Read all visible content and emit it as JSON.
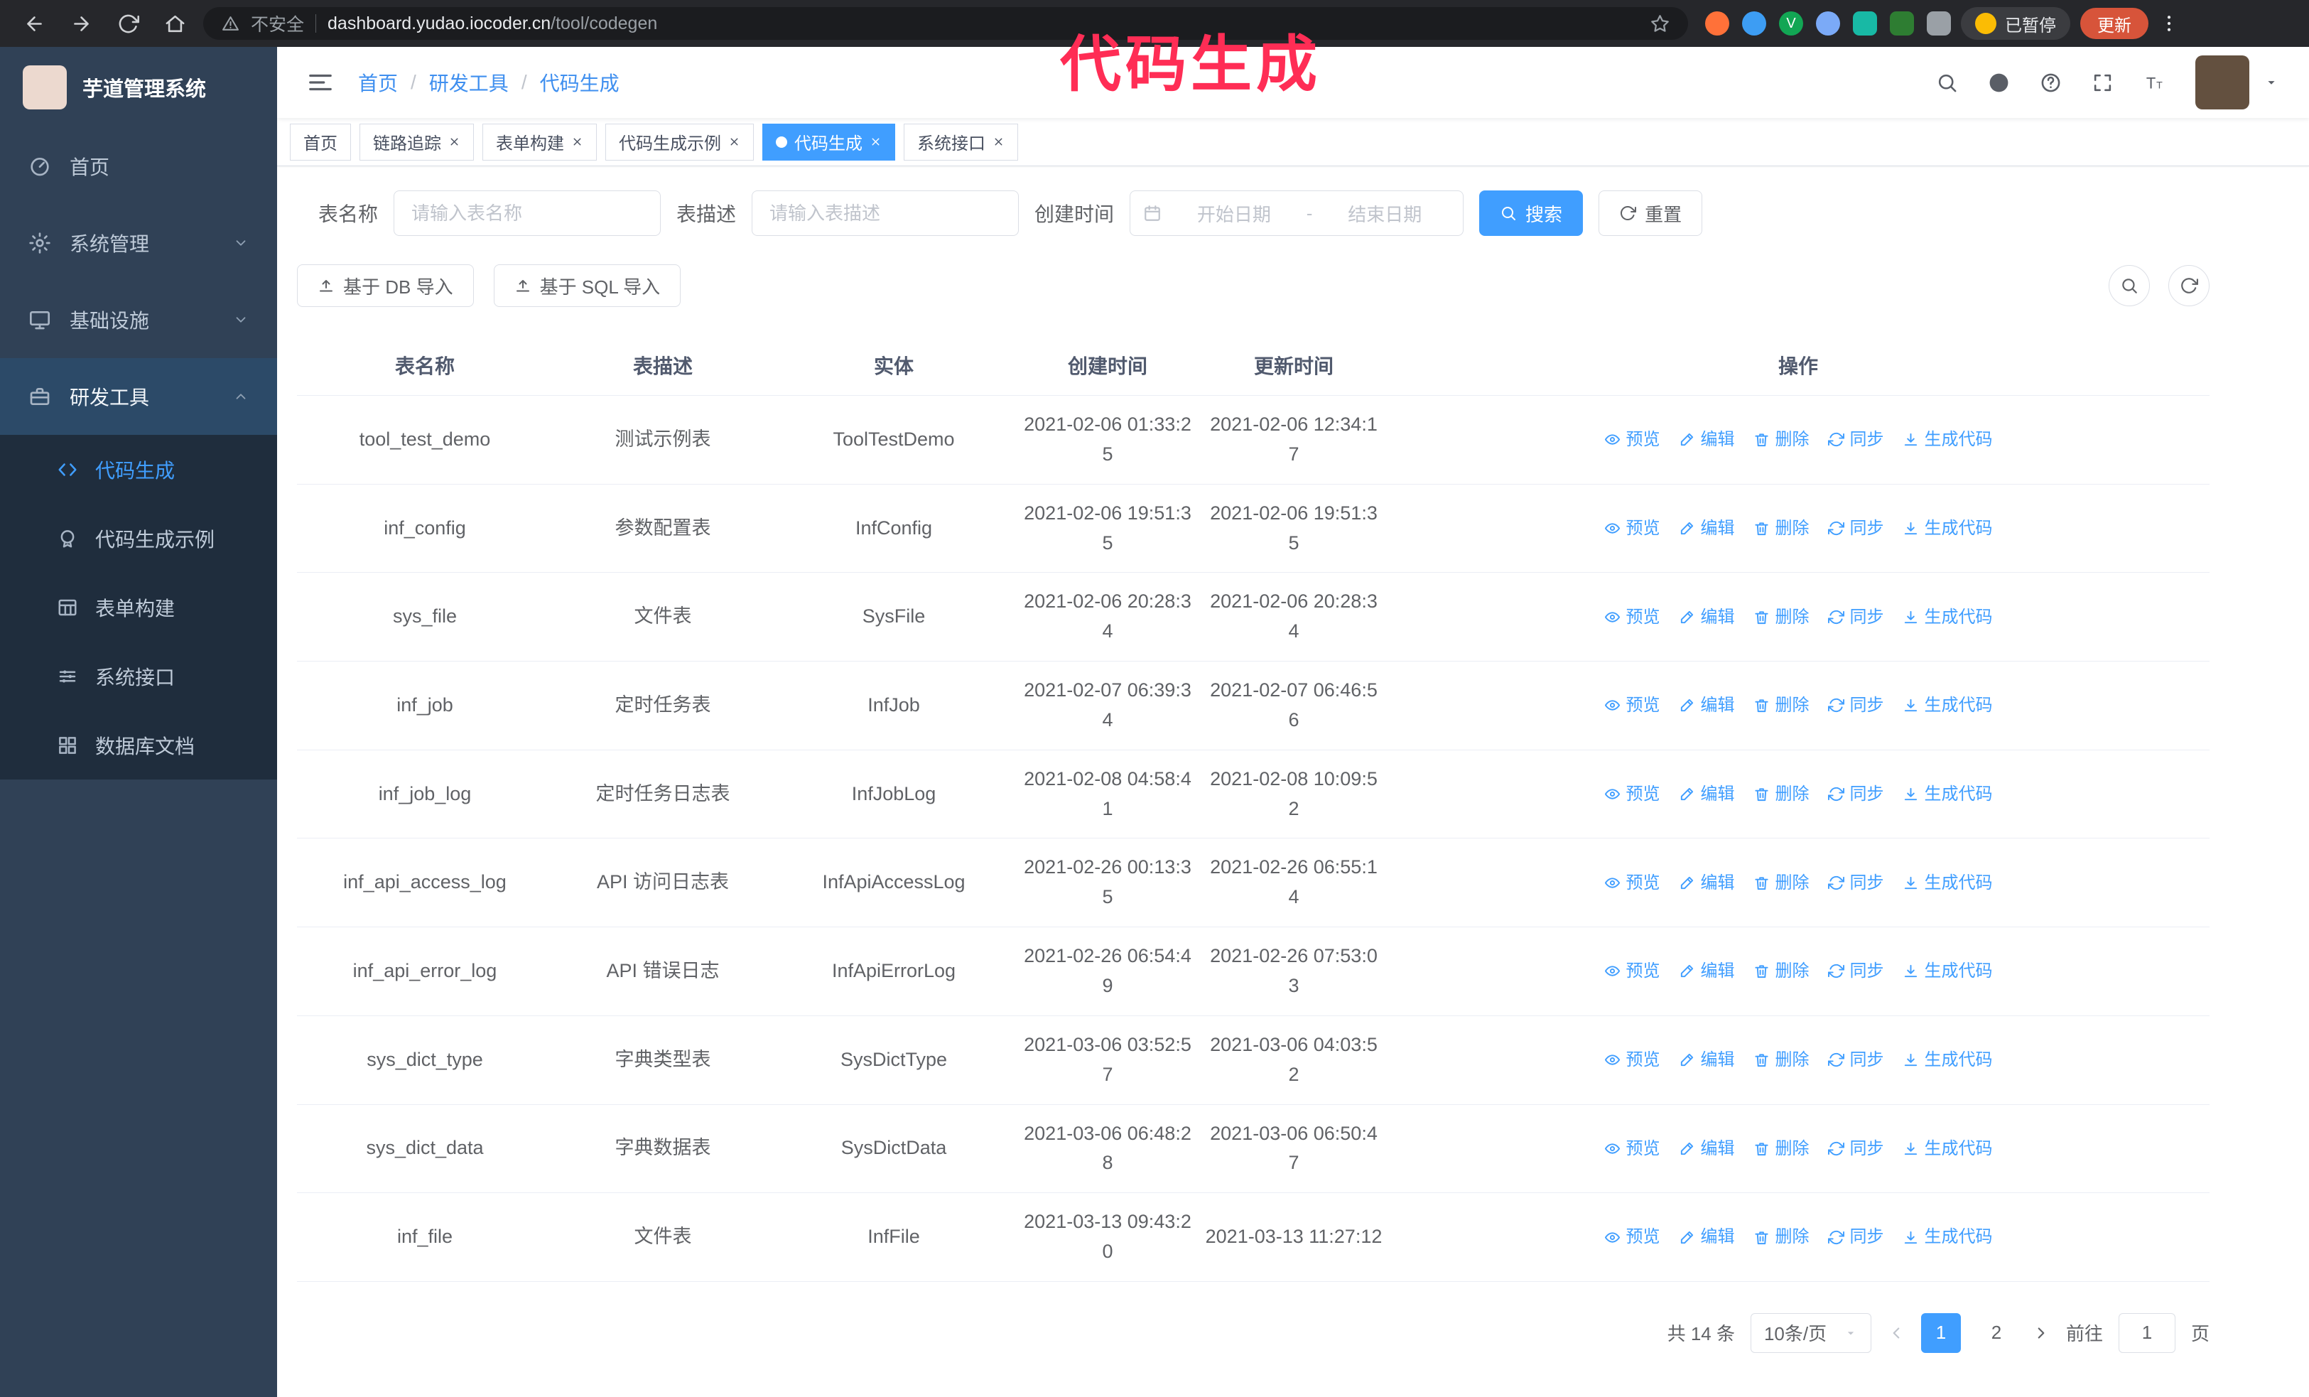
{
  "colors": {
    "accent": "#409eff",
    "sidebar_bg": "#304156",
    "submenu_bg": "#1f2d3d",
    "annotation": "#ff2d55",
    "browser_bg": "#26272b"
  },
  "browser": {
    "security_label": "不安全",
    "url_host": "dashboard.yudao.iocoder.cn",
    "url_path": "/tool/codegen",
    "paused_badge": "已暂停",
    "update_button": "更新",
    "icons": [
      "back-icon",
      "forward-icon",
      "reload-icon",
      "home-icon",
      "warning-icon",
      "star-icon",
      "extension-icons",
      "kebab-icon"
    ]
  },
  "annotation": {
    "text": "代码生成"
  },
  "sidebar": {
    "logo_title": "芋道管理系统",
    "menu": [
      {
        "label": "首页",
        "icon": "dashboard-icon"
      },
      {
        "label": "系统管理",
        "icon": "gear-icon",
        "chevron": "down"
      },
      {
        "label": "基础设施",
        "icon": "infra-icon",
        "chevron": "down"
      },
      {
        "label": "研发工具",
        "icon": "tools-icon",
        "chevron": "up",
        "active": true
      }
    ],
    "submenu": [
      {
        "label": "代码生成",
        "icon": "code-icon",
        "active": true
      },
      {
        "label": "代码生成示例",
        "icon": "example-icon"
      },
      {
        "label": "表单构建",
        "icon": "form-icon"
      },
      {
        "label": "系统接口",
        "icon": "api-icon"
      },
      {
        "label": "数据库文档",
        "icon": "dbdoc-icon"
      }
    ]
  },
  "header": {
    "separator": "/",
    "breadcrumb": [
      "首页",
      "研发工具",
      "代码生成"
    ],
    "icons": [
      "search-icon",
      "github-icon",
      "question-icon",
      "fullscreen-icon",
      "fontsize-icon",
      "caret-down-icon"
    ]
  },
  "tabbar": {
    "tabs": [
      {
        "label": "首页"
      },
      {
        "label": "链路追踪",
        "closable": true
      },
      {
        "label": "表单构建",
        "closable": true
      },
      {
        "label": "代码生成示例",
        "closable": true
      },
      {
        "label": "代码生成",
        "closable": true,
        "active": true
      },
      {
        "label": "系统接口",
        "closable": true
      }
    ]
  },
  "filters": {
    "table_name_label": "表名称",
    "table_name_placeholder": "请输入表名称",
    "table_desc_label": "表描述",
    "table_desc_placeholder": "请输入表描述",
    "create_time_label": "创建时间",
    "date_start_placeholder": "开始日期",
    "date_separator": "-",
    "date_end_placeholder": "结束日期",
    "search_button": "搜索",
    "reset_button": "重置"
  },
  "toolbar": {
    "import_db_button": "基于 DB 导入",
    "import_sql_button": "基于 SQL 导入",
    "right_icons": [
      "search-icon",
      "refresh-icon"
    ]
  },
  "table": {
    "columns": [
      "表名称",
      "表描述",
      "实体",
      "创建时间",
      "更新时间",
      "操作"
    ],
    "actions": [
      {
        "label": "预览",
        "icon": "eye-icon"
      },
      {
        "label": "编辑",
        "icon": "edit-icon"
      },
      {
        "label": "删除",
        "icon": "trash-icon"
      },
      {
        "label": "同步",
        "icon": "sync-icon"
      },
      {
        "label": "生成代码",
        "icon": "download-icon"
      }
    ],
    "rows": [
      {
        "name": "tool_test_demo",
        "desc": "测试示例表",
        "entity": "ToolTestDemo",
        "created": "2021-02-06 01:33:25",
        "updated": "2021-02-06 12:34:17"
      },
      {
        "name": "inf_config",
        "desc": "参数配置表",
        "entity": "InfConfig",
        "created": "2021-02-06 19:51:35",
        "updated": "2021-02-06 19:51:35"
      },
      {
        "name": "sys_file",
        "desc": "文件表",
        "entity": "SysFile",
        "created": "2021-02-06 20:28:34",
        "updated": "2021-02-06 20:28:34"
      },
      {
        "name": "inf_job",
        "desc": "定时任务表",
        "entity": "InfJob",
        "created": "2021-02-07 06:39:34",
        "updated": "2021-02-07 06:46:56"
      },
      {
        "name": "inf_job_log",
        "desc": "定时任务日志表",
        "entity": "InfJobLog",
        "created": "2021-02-08 04:58:41",
        "updated": "2021-02-08 10:09:52"
      },
      {
        "name": "inf_api_access_log",
        "desc": "API 访问日志表",
        "entity": "InfApiAccessLog",
        "created": "2021-02-26 00:13:35",
        "updated": "2021-02-26 06:55:14"
      },
      {
        "name": "inf_api_error_log",
        "desc": "API 错误日志",
        "entity": "InfApiErrorLog",
        "created": "2021-02-26 06:54:49",
        "updated": "2021-02-26 07:53:03"
      },
      {
        "name": "sys_dict_type",
        "desc": "字典类型表",
        "entity": "SysDictType",
        "created": "2021-03-06 03:52:57",
        "updated": "2021-03-06 04:03:52"
      },
      {
        "name": "sys_dict_data",
        "desc": "字典数据表",
        "entity": "SysDictData",
        "created": "2021-03-06 06:48:28",
        "updated": "2021-03-06 06:50:47"
      },
      {
        "name": "inf_file",
        "desc": "文件表",
        "entity": "InfFile",
        "created": "2021-03-13 09:43:20",
        "updated": "2021-03-13 11:27:12"
      }
    ]
  },
  "pagination": {
    "total_text": "共 14 条",
    "page_size": "10条/页",
    "pages": [
      "1",
      "2"
    ],
    "active_page": "1",
    "goto_prefix": "前往",
    "goto_value": "1",
    "goto_suffix": "页"
  }
}
